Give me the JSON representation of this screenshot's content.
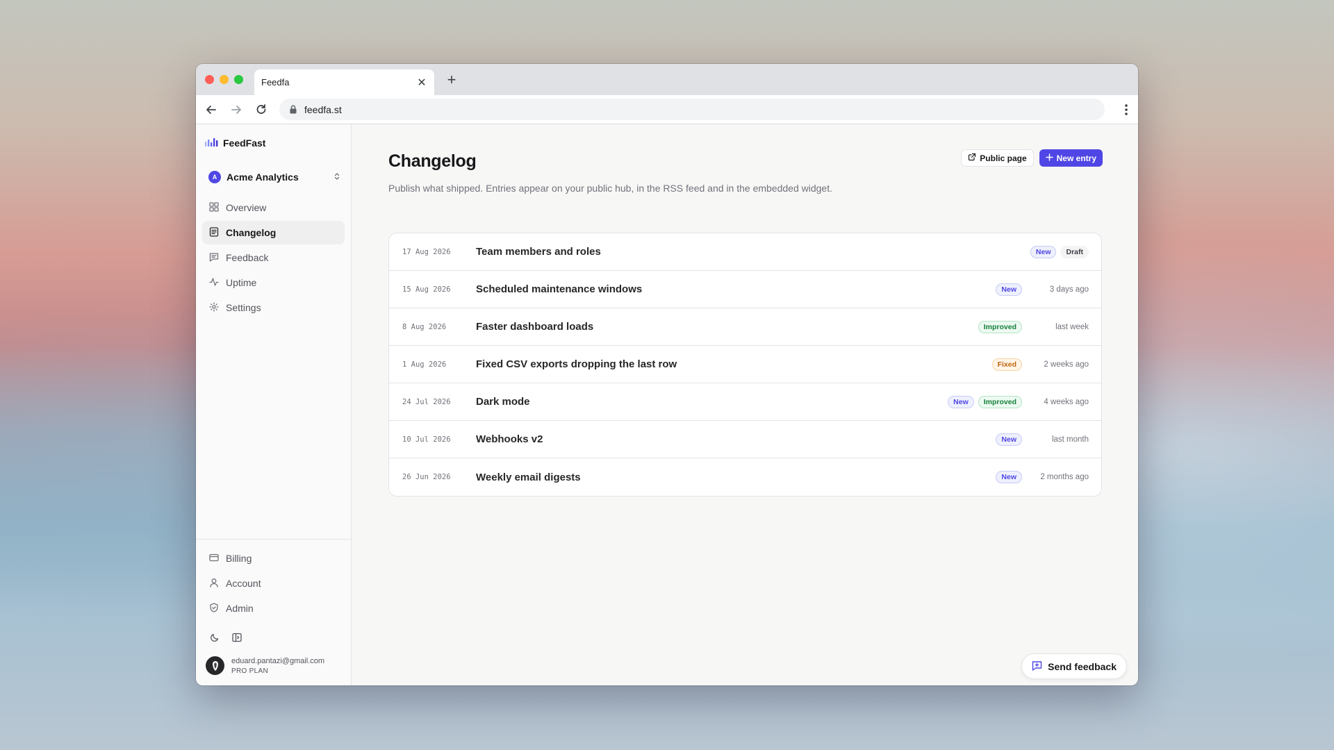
{
  "browser": {
    "tab_title": "Feedfa",
    "url": "feedfa.st"
  },
  "sidebar": {
    "brand": "FeedFast",
    "workspace": {
      "initial": "A",
      "name": "Acme Analytics"
    },
    "nav": [
      {
        "label": "Overview",
        "icon": "grid-icon"
      },
      {
        "label": "Changelog",
        "icon": "changelog-icon",
        "active": true
      },
      {
        "label": "Feedback",
        "icon": "message-icon"
      },
      {
        "label": "Uptime",
        "icon": "activity-icon"
      },
      {
        "label": "Settings",
        "icon": "gear-icon"
      }
    ],
    "bottom_nav": [
      {
        "label": "Billing",
        "icon": "credit-card-icon"
      },
      {
        "label": "Account",
        "icon": "user-icon"
      },
      {
        "label": "Admin",
        "icon": "shield-icon"
      }
    ],
    "user": {
      "email": "eduard.pantazi@gmail.com",
      "plan": "PRO PLAN"
    }
  },
  "main": {
    "title": "Changelog",
    "description": "Publish what shipped. Entries appear on your public hub, in the RSS feed and in the embedded widget.",
    "public_page_label": "Public page",
    "new_entry_label": "New entry",
    "entries": [
      {
        "date": "17 Aug 2026",
        "title": "Team members and roles",
        "badges": [
          "New",
          "Draft"
        ],
        "when": ""
      },
      {
        "date": "15 Aug 2026",
        "title": "Scheduled maintenance windows",
        "badges": [
          "New"
        ],
        "when": "3 days ago"
      },
      {
        "date": "8 Aug 2026",
        "title": "Faster dashboard loads",
        "badges": [
          "Improved"
        ],
        "when": "last week"
      },
      {
        "date": "1 Aug 2026",
        "title": "Fixed CSV exports dropping the last row",
        "badges": [
          "Fixed"
        ],
        "when": "2 weeks ago"
      },
      {
        "date": "24 Jul 2026",
        "title": "Dark mode",
        "badges": [
          "New",
          "Improved"
        ],
        "when": "4 weeks ago"
      },
      {
        "date": "10 Jul 2026",
        "title": "Webhooks v2",
        "badges": [
          "New"
        ],
        "when": "last month"
      },
      {
        "date": "26 Jun 2026",
        "title": "Weekly email digests",
        "badges": [
          "New"
        ],
        "when": "2 months ago"
      }
    ],
    "send_feedback_label": "Send feedback"
  },
  "colors": {
    "accent": "#4f46e5",
    "badge_new": "#4f46e5",
    "badge_improved": "#15803d",
    "badge_fixed": "#c2650c"
  }
}
